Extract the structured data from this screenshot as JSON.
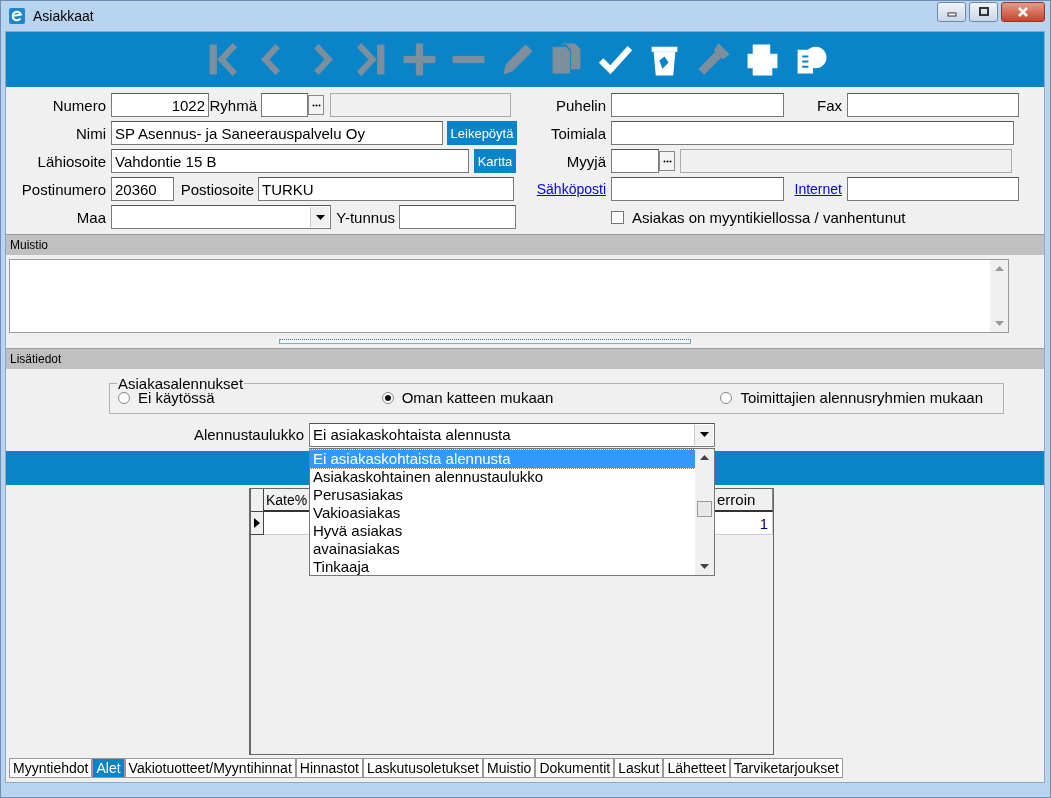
{
  "window": {
    "title": "Asiakkaat"
  },
  "toolbar": [
    {
      "kind": "first",
      "disabled": true
    },
    {
      "kind": "prev",
      "disabled": true
    },
    {
      "kind": "next",
      "disabled": true
    },
    {
      "kind": "last",
      "disabled": true
    },
    {
      "kind": "add",
      "disabled": true
    },
    {
      "kind": "remove",
      "disabled": true
    },
    {
      "kind": "edit",
      "disabled": true
    },
    {
      "kind": "copy",
      "disabled": true
    },
    {
      "kind": "save",
      "disabled": false
    },
    {
      "kind": "delete",
      "disabled": false
    },
    {
      "kind": "flashlight",
      "disabled": true
    },
    {
      "kind": "print",
      "disabled": false
    },
    {
      "kind": "globe",
      "disabled": false
    }
  ],
  "form": {
    "numero": {
      "label": "Numero",
      "value": "1022"
    },
    "ryhma": {
      "label": "Ryhmä"
    },
    "nimi": {
      "label": "Nimi",
      "value": "SP Asennus- ja Saneerauspalvelu Oy"
    },
    "leikepoyta_button": "Leikepöytä",
    "lahiosoite": {
      "label": "Lähiosoite",
      "value": "Vahdontie 15 B"
    },
    "kartta_button": "Kartta",
    "postinumero": {
      "label": "Postinumero",
      "value": "20360"
    },
    "postiosoite": {
      "label": "Postiosoite",
      "value": "TURKU"
    },
    "maa": {
      "label": "Maa"
    },
    "ytunnus": {
      "label": "Y-tunnus"
    },
    "puhelin": {
      "label": "Puhelin"
    },
    "fax": {
      "label": "Fax"
    },
    "toimiala": {
      "label": "Toimiala"
    },
    "myyja": {
      "label": "Myyjä"
    },
    "sahkoposti": {
      "label": "Sähköposti"
    },
    "internet": {
      "label": "Internet"
    },
    "myyntikielto": {
      "label": "Asiakas on myyntikiellossa / vanhentunut",
      "checked": false
    }
  },
  "muistio": {
    "header": "Muistio"
  },
  "lisatiedot": {
    "header": "Lisätiedot"
  },
  "discounts": {
    "legend": "Asiakasalennukset",
    "options": [
      {
        "label": "Ei käytössä",
        "selected": false
      },
      {
        "label": "Oman katteen mukaan",
        "selected": true
      },
      {
        "label": "Toimittajien alennusryhmien mukaan",
        "selected": false
      }
    ]
  },
  "discount_table": {
    "label": "Alennustaulukko",
    "value": "Ei asiakaskohtaista alennusta",
    "expanded": true,
    "options": [
      {
        "label": "Ei asiakaskohtaista alennusta",
        "selected": true
      },
      {
        "label": "Asiakaskohtainen alennustaulukko",
        "selected": false
      },
      {
        "label": "Perusasiakas",
        "selected": false
      },
      {
        "label": "Vakioasiakas",
        "selected": false
      },
      {
        "label": "Hyvä asiakas",
        "selected": false
      },
      {
        "label": "avainasiakas",
        "selected": false
      },
      {
        "label": "Tinkaaja",
        "selected": false
      }
    ]
  },
  "grid": {
    "columns": [
      "Kate%",
      "erroin"
    ],
    "rows": [
      {
        "current": true,
        "value": "1"
      }
    ]
  },
  "tabs": [
    {
      "label": "Myyntiehdot",
      "selected": false
    },
    {
      "label": "Alet",
      "selected": true
    },
    {
      "label": "Vakiotuotteet/Myyntihinnat",
      "selected": false
    },
    {
      "label": "Hinnastot",
      "selected": false
    },
    {
      "label": "Laskutusoletukset",
      "selected": false
    },
    {
      "label": "Muistio",
      "selected": false
    },
    {
      "label": "Dokumentit",
      "selected": false
    },
    {
      "label": "Laskut",
      "selected": false
    },
    {
      "label": "Lähetteet",
      "selected": false
    },
    {
      "label": "Tarviketarjoukset",
      "selected": false
    }
  ]
}
